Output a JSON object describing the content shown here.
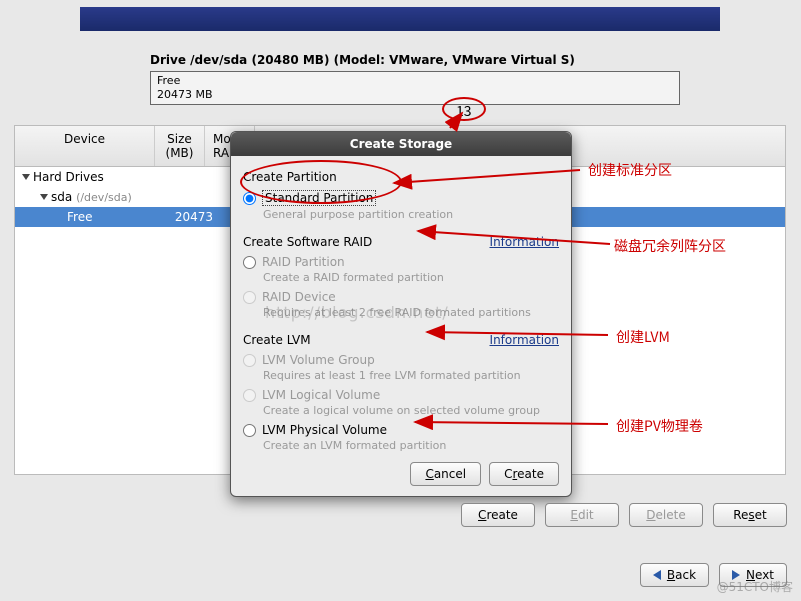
{
  "drive": {
    "title": "Drive /dev/sda (20480 MB) (Model: VMware, VMware Virtual S)",
    "free_label": "Free",
    "free_size": "20473 MB"
  },
  "annotation_13": "13",
  "table": {
    "headers": {
      "device": "Device",
      "size": "Size\n(MB)",
      "mount": "Mou\nRAID"
    },
    "rows": {
      "hd": "Hard Drives",
      "sda": "sda",
      "sda_path": "(/dev/sda)",
      "free": "Free",
      "free_size": "20473"
    }
  },
  "dialog": {
    "title": "Create Storage",
    "sec_partition": "Create Partition",
    "opt_standard": "Standard Partition",
    "desc_standard": "General purpose partition creation",
    "sec_raid": "Create Software RAID",
    "info": "Information",
    "opt_raid_part": "RAID Partition",
    "desc_raid_part": "Create a RAID formated partition",
    "opt_raid_dev": "RAID Device",
    "desc_raid_dev": "Requires at least 2 free RAID formated partitions",
    "sec_lvm": "Create LVM",
    "opt_vg": "LVM Volume Group",
    "desc_vg": "Requires at least 1 free LVM formated partition",
    "opt_lv": "LVM Logical Volume",
    "desc_lv": "Create a logical volume on selected volume group",
    "opt_pv": "LVM Physical Volume",
    "desc_pv": "Create an LVM formated partition",
    "cancel": "Cancel",
    "create": "Create"
  },
  "bottom": {
    "create": "Create",
    "edit": "Edit",
    "delete": "Delete",
    "reset": "Reset"
  },
  "nav": {
    "back": "Back",
    "next": "Next"
  },
  "annotations": {
    "std": "创建标准分区",
    "raid": "磁盘冗余列阵分区",
    "lvm": "创建LVM",
    "pv": "创建PV物理卷"
  },
  "watermark": "http://blog.csdn.net/",
  "corner": "@51CTO博客"
}
